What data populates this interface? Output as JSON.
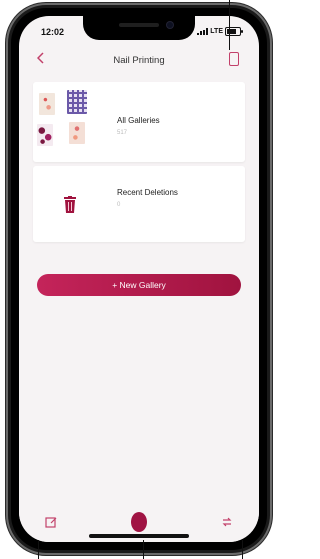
{
  "status": {
    "time": "12:02",
    "network": "LTE"
  },
  "nav": {
    "back_icon": "chevron-left-icon",
    "title": "Nail Printing",
    "action_icon": "phone-icon"
  },
  "galleries": [
    {
      "name": "All Galleries",
      "subtitle": "517"
    },
    {
      "name": "Recent Deletions",
      "subtitle": "0"
    }
  ],
  "new_gallery_label": "+ New Gallery",
  "toolbar": {
    "left_icon": "edit-icon",
    "center_icon": "nail-icon",
    "right_icon": "sync-icon"
  },
  "colors": {
    "accent": "#c2406a",
    "button": "#b31d4f"
  }
}
